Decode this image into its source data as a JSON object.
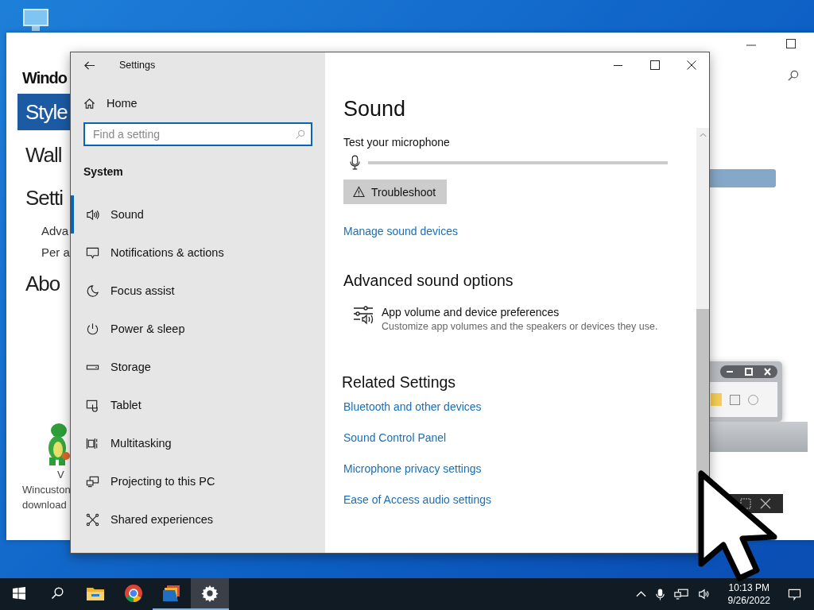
{
  "background_window": {
    "heading": "Windo",
    "menu": [
      {
        "label": "Style",
        "selected": true
      },
      {
        "label": "Wall",
        "selected": false
      },
      {
        "label": "Setti",
        "selected": false
      }
    ],
    "submenu": [
      "Adva",
      "Per a"
    ],
    "about": "Abo",
    "promo": [
      "V",
      "Wincuston",
      "download"
    ]
  },
  "settings": {
    "title": "Settings",
    "home": "Home",
    "search": {
      "placeholder": "Find a setting"
    },
    "section": "System",
    "nav": [
      {
        "label": "Sound",
        "kind": "sound",
        "selected": true
      },
      {
        "label": "Notifications & actions",
        "kind": "notifications",
        "selected": false
      },
      {
        "label": "Focus assist",
        "kind": "focus",
        "selected": false
      },
      {
        "label": "Power & sleep",
        "kind": "power",
        "selected": false
      },
      {
        "label": "Storage",
        "kind": "storage",
        "selected": false
      },
      {
        "label": "Tablet",
        "kind": "tablet",
        "selected": false
      },
      {
        "label": "Multitasking",
        "kind": "multitasking",
        "selected": false
      },
      {
        "label": "Projecting to this PC",
        "kind": "projecting",
        "selected": false
      },
      {
        "label": "Shared experiences",
        "kind": "shared",
        "selected": false
      }
    ],
    "page_title": "Sound",
    "mic_test": {
      "label": "Test your microphone",
      "level": 0
    },
    "troubleshoot": "Troubleshoot",
    "manage_link": "Manage sound devices",
    "advanced": {
      "heading": "Advanced sound options",
      "title": "App volume and device preferences",
      "description": "Customize app volumes and the speakers or devices they use."
    },
    "related": {
      "heading": "Related Settings",
      "links": [
        "Bluetooth and other devices",
        "Sound Control Panel",
        "Microphone privacy settings",
        "Ease of Access audio settings"
      ]
    }
  },
  "taskbar": {
    "apps": [
      {
        "kind": "explorer",
        "running": false,
        "selected": false
      },
      {
        "kind": "browser",
        "running": false,
        "selected": false
      },
      {
        "kind": "colors",
        "running": true,
        "selected": false
      },
      {
        "kind": "settings",
        "running": true,
        "selected": true
      }
    ],
    "time": "10:13 PM",
    "date": "9/26/2022"
  }
}
